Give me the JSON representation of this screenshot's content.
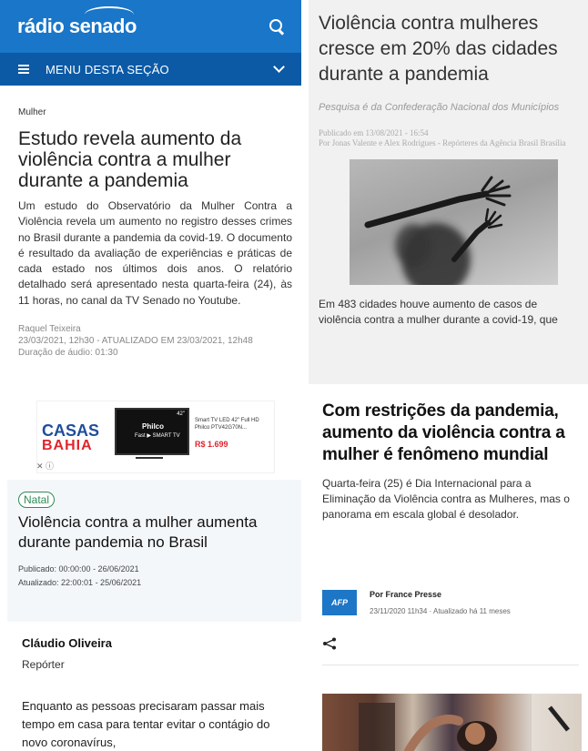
{
  "panel1": {
    "logo": "rádio senado",
    "menu_label": "MENU DESTA SEÇÃO",
    "category": "Mulher",
    "title": "Estudo revela aumento da violência contra a mulher durante a pandemia",
    "body": "Um estudo do Observatório da Mulher Contra a Violência revela um aumento no registro desses crimes no Brasil durante a pandemia da covid-19. O documento é resultado da avaliação de experiências e práticas de cada estado nos últimos dois anos. O relatório detalhado será apresentado nesta quarta-feira (24), às 11 horas, no canal da TV Senado no Youtube.",
    "author": "Raquel Teixeira",
    "date": "23/03/2021, 12h30 - ATUALIZADO EM 23/03/2021, 12h48",
    "duration": "Duração de áudio: 01:30",
    "colors": {
      "header": "#1976c9",
      "menu": "#0c5aa6"
    }
  },
  "panel2": {
    "title": "Violência contra mulheres cresce em 20% das cidades durante a pandemia",
    "subtitle": "Pesquisa é da Confederação Nacional dos Municípios",
    "published": "Publicado em 13/08/2021 - 16:54",
    "byline": "Por Jonas Valente e Alex Rodrigues - Repórteres da Agência Brasil Brasília",
    "body": "Em 483 cidades houve aumento de casos de violência contra a mulher durante a covid-19, que"
  },
  "panel3": {
    "ad": {
      "brand_line1": "CASAS",
      "brand_line2": "BAHIA",
      "tv_brand": "Philco",
      "tv_sub": "Fast ▶ SMART TV",
      "tv_size": "42\"",
      "description": "Smart TV LED 42\" Full HD Philco PTV42G70N...",
      "price": "R$ 1.699",
      "close": "✕ ⓘ"
    },
    "tag": "Natal",
    "title": "Violência contra a mulher aumenta durante pandemia no Brasil",
    "published": "Publicado: 00:00:00 - 26/06/2021",
    "updated": "Atualizado: 22:00:01 - 25/06/2021",
    "author": "Cláudio Oliveira",
    "role": "Repórter",
    "body": "Enquanto as pessoas precisaram passar mais tempo em casa para tentar evitar o contágio do novo coronavírus,"
  },
  "panel4": {
    "title": "Com restrições da pandemia, aumento da violência contra a mulher é fenômeno mundial",
    "subtitle": "Quarta-feira (25) é Dia Internacional para a Eliminação da Violência contra as Mulheres, mas o panorama em escala global é desolador.",
    "agency_logo": "AFP",
    "byline": "Por France Presse",
    "date": "23/11/2020 11h34 · Atualizado há 11 meses",
    "share_icon": "share-icon"
  }
}
